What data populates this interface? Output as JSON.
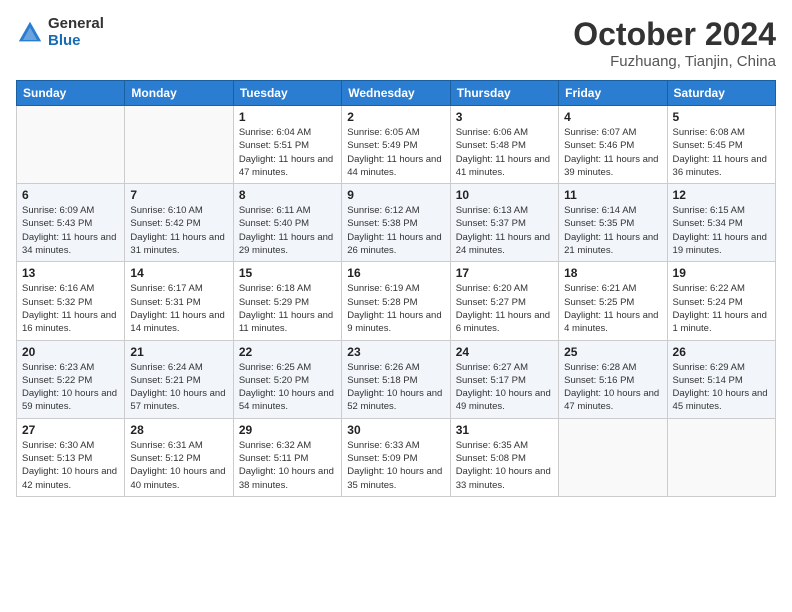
{
  "header": {
    "logo_general": "General",
    "logo_blue": "Blue",
    "title": "October 2024",
    "location": "Fuzhuang, Tianjin, China"
  },
  "weekdays": [
    "Sunday",
    "Monday",
    "Tuesday",
    "Wednesday",
    "Thursday",
    "Friday",
    "Saturday"
  ],
  "weeks": [
    {
      "rowClass": "row-odd",
      "days": [
        {
          "date": "",
          "info": "",
          "empty": true
        },
        {
          "date": "",
          "info": "",
          "empty": true
        },
        {
          "date": "1",
          "info": "Sunrise: 6:04 AM\nSunset: 5:51 PM\nDaylight: 11 hours and 47 minutes."
        },
        {
          "date": "2",
          "info": "Sunrise: 6:05 AM\nSunset: 5:49 PM\nDaylight: 11 hours and 44 minutes."
        },
        {
          "date": "3",
          "info": "Sunrise: 6:06 AM\nSunset: 5:48 PM\nDaylight: 11 hours and 41 minutes."
        },
        {
          "date": "4",
          "info": "Sunrise: 6:07 AM\nSunset: 5:46 PM\nDaylight: 11 hours and 39 minutes."
        },
        {
          "date": "5",
          "info": "Sunrise: 6:08 AM\nSunset: 5:45 PM\nDaylight: 11 hours and 36 minutes."
        }
      ]
    },
    {
      "rowClass": "row-even",
      "days": [
        {
          "date": "6",
          "info": "Sunrise: 6:09 AM\nSunset: 5:43 PM\nDaylight: 11 hours and 34 minutes."
        },
        {
          "date": "7",
          "info": "Sunrise: 6:10 AM\nSunset: 5:42 PM\nDaylight: 11 hours and 31 minutes."
        },
        {
          "date": "8",
          "info": "Sunrise: 6:11 AM\nSunset: 5:40 PM\nDaylight: 11 hours and 29 minutes."
        },
        {
          "date": "9",
          "info": "Sunrise: 6:12 AM\nSunset: 5:38 PM\nDaylight: 11 hours and 26 minutes."
        },
        {
          "date": "10",
          "info": "Sunrise: 6:13 AM\nSunset: 5:37 PM\nDaylight: 11 hours and 24 minutes."
        },
        {
          "date": "11",
          "info": "Sunrise: 6:14 AM\nSunset: 5:35 PM\nDaylight: 11 hours and 21 minutes."
        },
        {
          "date": "12",
          "info": "Sunrise: 6:15 AM\nSunset: 5:34 PM\nDaylight: 11 hours and 19 minutes."
        }
      ]
    },
    {
      "rowClass": "row-odd",
      "days": [
        {
          "date": "13",
          "info": "Sunrise: 6:16 AM\nSunset: 5:32 PM\nDaylight: 11 hours and 16 minutes."
        },
        {
          "date": "14",
          "info": "Sunrise: 6:17 AM\nSunset: 5:31 PM\nDaylight: 11 hours and 14 minutes."
        },
        {
          "date": "15",
          "info": "Sunrise: 6:18 AM\nSunset: 5:29 PM\nDaylight: 11 hours and 11 minutes."
        },
        {
          "date": "16",
          "info": "Sunrise: 6:19 AM\nSunset: 5:28 PM\nDaylight: 11 hours and 9 minutes."
        },
        {
          "date": "17",
          "info": "Sunrise: 6:20 AM\nSunset: 5:27 PM\nDaylight: 11 hours and 6 minutes."
        },
        {
          "date": "18",
          "info": "Sunrise: 6:21 AM\nSunset: 5:25 PM\nDaylight: 11 hours and 4 minutes."
        },
        {
          "date": "19",
          "info": "Sunrise: 6:22 AM\nSunset: 5:24 PM\nDaylight: 11 hours and 1 minute."
        }
      ]
    },
    {
      "rowClass": "row-even",
      "days": [
        {
          "date": "20",
          "info": "Sunrise: 6:23 AM\nSunset: 5:22 PM\nDaylight: 10 hours and 59 minutes."
        },
        {
          "date": "21",
          "info": "Sunrise: 6:24 AM\nSunset: 5:21 PM\nDaylight: 10 hours and 57 minutes."
        },
        {
          "date": "22",
          "info": "Sunrise: 6:25 AM\nSunset: 5:20 PM\nDaylight: 10 hours and 54 minutes."
        },
        {
          "date": "23",
          "info": "Sunrise: 6:26 AM\nSunset: 5:18 PM\nDaylight: 10 hours and 52 minutes."
        },
        {
          "date": "24",
          "info": "Sunrise: 6:27 AM\nSunset: 5:17 PM\nDaylight: 10 hours and 49 minutes."
        },
        {
          "date": "25",
          "info": "Sunrise: 6:28 AM\nSunset: 5:16 PM\nDaylight: 10 hours and 47 minutes."
        },
        {
          "date": "26",
          "info": "Sunrise: 6:29 AM\nSunset: 5:14 PM\nDaylight: 10 hours and 45 minutes."
        }
      ]
    },
    {
      "rowClass": "row-odd",
      "days": [
        {
          "date": "27",
          "info": "Sunrise: 6:30 AM\nSunset: 5:13 PM\nDaylight: 10 hours and 42 minutes."
        },
        {
          "date": "28",
          "info": "Sunrise: 6:31 AM\nSunset: 5:12 PM\nDaylight: 10 hours and 40 minutes."
        },
        {
          "date": "29",
          "info": "Sunrise: 6:32 AM\nSunset: 5:11 PM\nDaylight: 10 hours and 38 minutes."
        },
        {
          "date": "30",
          "info": "Sunrise: 6:33 AM\nSunset: 5:09 PM\nDaylight: 10 hours and 35 minutes."
        },
        {
          "date": "31",
          "info": "Sunrise: 6:35 AM\nSunset: 5:08 PM\nDaylight: 10 hours and 33 minutes."
        },
        {
          "date": "",
          "info": "",
          "empty": true
        },
        {
          "date": "",
          "info": "",
          "empty": true
        }
      ]
    }
  ]
}
